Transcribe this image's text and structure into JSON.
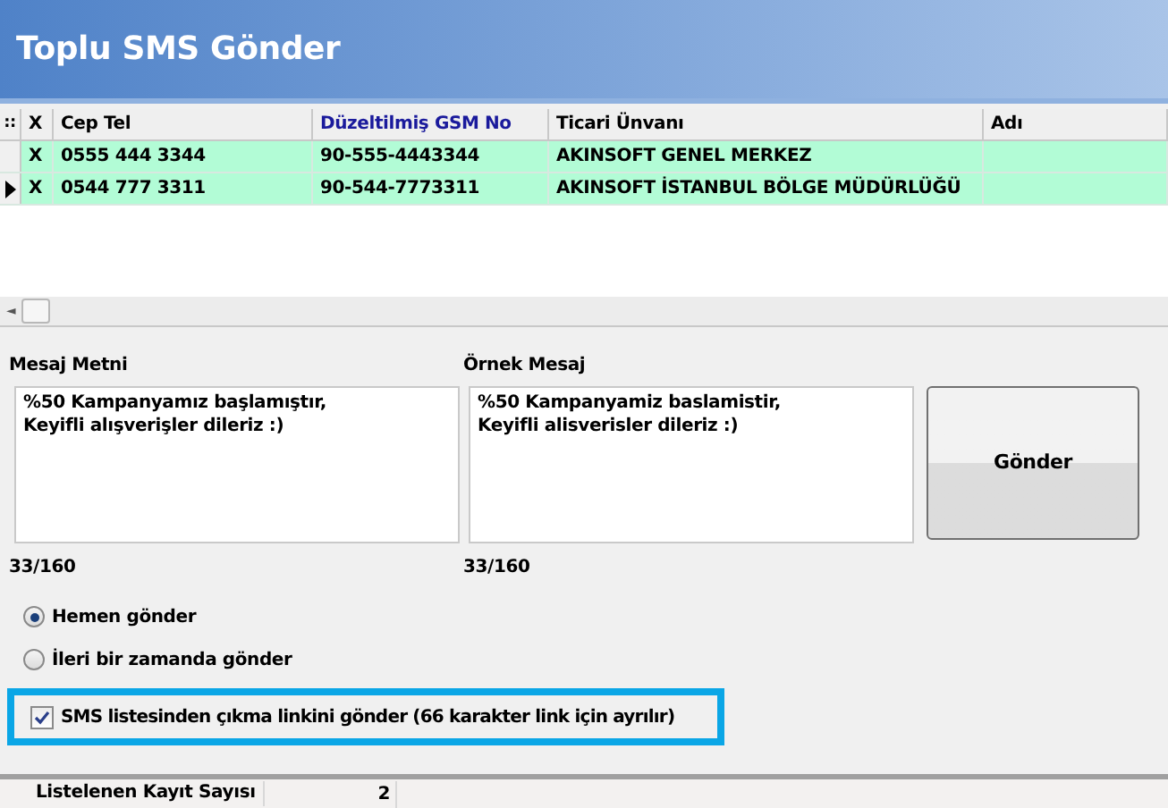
{
  "window": {
    "title": "Toplu SMS Gönder"
  },
  "table": {
    "corner": "::",
    "columns": [
      {
        "label": "X",
        "highlighted": false
      },
      {
        "label": "Cep Tel",
        "highlighted": false
      },
      {
        "label": "Düzeltilmiş GSM No",
        "highlighted": true
      },
      {
        "label": "Ticari Ünvanı",
        "highlighted": false
      },
      {
        "label": "Adı",
        "highlighted": false
      }
    ],
    "rows": [
      {
        "current": false,
        "cells": [
          "X",
          "0555 444 3344",
          "90-555-4443344",
          "AKINSOFT GENEL MERKEZ",
          null
        ]
      },
      {
        "current": true,
        "cells": [
          "X",
          "0544 777 3311",
          "90-544-7773311",
          "AKINSOFT İSTANBUL BÖLGE MÜDÜRLÜĞÜ",
          null
        ]
      }
    ]
  },
  "scroll_left": "◄",
  "message": {
    "label": "Mesaj Metni",
    "value": "%50 Kampanyamız başlamıştır,\nKeyifli alışverişler dileriz :)",
    "count": "33/160"
  },
  "preview": {
    "label": "Örnek Mesaj",
    "value": "%50 Kampanyamiz baslamistir,\nKeyifli alisverisler dileriz :)",
    "count": "33/160"
  },
  "send_button": "Gönder",
  "schedule": [
    {
      "label": "Hemen gönder",
      "selected": true
    },
    {
      "label": "İleri bir zamanda gönder",
      "selected": false
    }
  ],
  "unsubscribe": {
    "label": "SMS listesinden çıkma linkini gönder (66 karakter link için ayrılır)",
    "checked": true,
    "highlighted": true
  },
  "status_bar": {
    "label": "Listelenen Kayıt Sayısı",
    "value": "2"
  }
}
